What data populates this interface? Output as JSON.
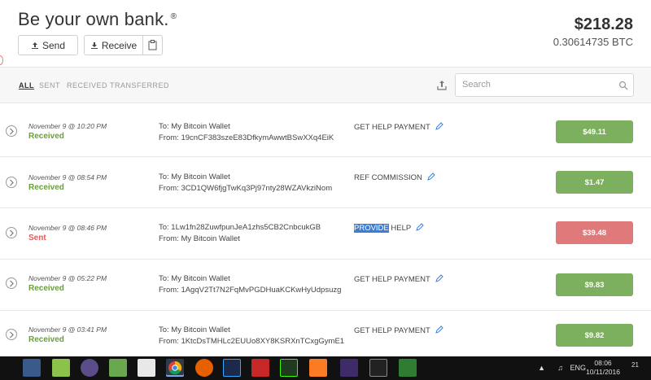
{
  "header": {
    "brand": "Be your own bank.",
    "brand_mark": "®",
    "send_label": "Send",
    "receive_label": "Receive",
    "balance_usd": "$218.28",
    "balance_btc": "0.30614735 BTC"
  },
  "filters": {
    "tabs": [
      {
        "label": "ALL",
        "active": true
      },
      {
        "label": "SENT",
        "active": false
      },
      {
        "label": "RECEIVED",
        "active": false
      },
      {
        "label": "TRANSFERRED",
        "active": false
      }
    ],
    "search_placeholder": "Search"
  },
  "transactions": [
    {
      "date": "November 9 @ 10:20 PM",
      "status": "Received",
      "to": "To: My Bitcoin Wallet",
      "from": "From: 19cnCF383szeE83DfkymAwwtBSwXXq4EiK",
      "desc_hl": "",
      "desc": "GET HELP PAYMENT",
      "amount": "$49.11",
      "kind": "received"
    },
    {
      "date": "November 9 @ 08:54 PM",
      "status": "Received",
      "to": "To: My Bitcoin Wallet",
      "from": "From: 3CD1QW6fjgTwKq3Pj97nty28WZAVkziNom",
      "desc_hl": "",
      "desc": "REF COMMISSION",
      "amount": "$1.47",
      "kind": "received"
    },
    {
      "date": "November 9 @ 08:46 PM",
      "status": "Sent",
      "to": "To: 1Lw1fn28ZuwfpunJeA1zhs5CB2CnbcukGB",
      "from": "From: My Bitcoin Wallet",
      "desc_hl": "PROVIDE",
      "desc": " HELP",
      "amount": "$39.48",
      "kind": "sent"
    },
    {
      "date": "November 9 @ 05:22 PM",
      "status": "Received",
      "to": "To: My Bitcoin Wallet",
      "from": "From: 1AgqV2Tt7N2FqMvPGDHuaKCKwHyUdpsuzg",
      "desc_hl": "",
      "desc": "GET HELP PAYMENT",
      "amount": "$9.83",
      "kind": "received"
    },
    {
      "date": "November 9 @ 03:41 PM",
      "status": "Received",
      "to": "To: My Bitcoin Wallet",
      "from": "From: 1KtcDsTMHLc2EUUo8XY8KSRXnTCxgGymE1",
      "desc_hl": "",
      "desc": "GET HELP PAYMENT",
      "amount": "$9.82",
      "kind": "received"
    }
  ],
  "taskbar": {
    "language": "ENG",
    "time": "08:06",
    "date": "10/11/2016",
    "notifications": "21",
    "apps": [
      "file-explorer",
      "bluestacks",
      "winamp",
      "greenshot",
      "notepad",
      "chrome",
      "firefox",
      "photoshop",
      "acrobat",
      "dreamweaver",
      "xampp",
      "visual-studio",
      "command-prompt",
      "store"
    ]
  },
  "colors": {
    "received": "#6a9e3a",
    "sent": "#e05c5c",
    "amount_positive": "#7db05e",
    "amount_negative": "#e07a7a"
  }
}
